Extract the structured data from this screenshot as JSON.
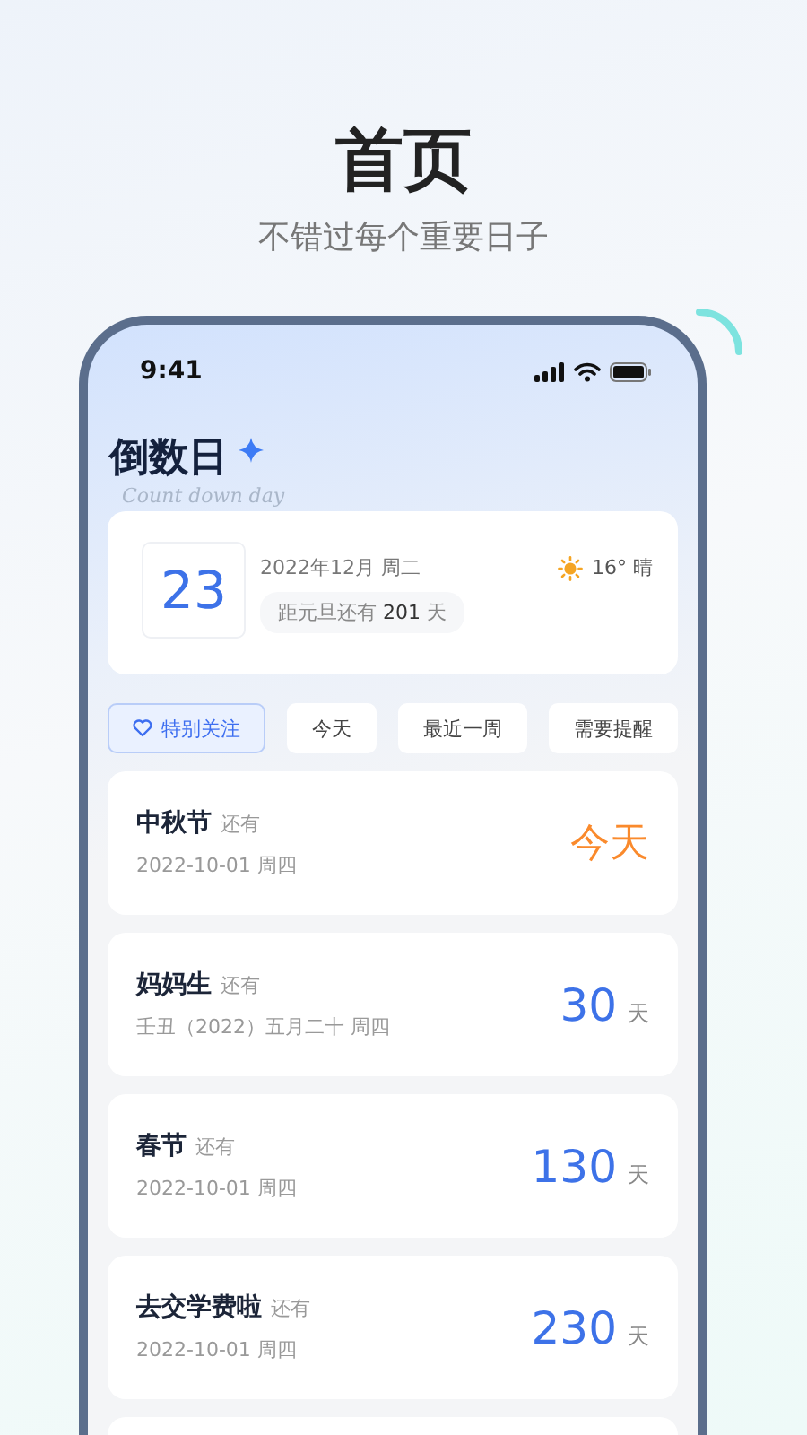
{
  "headline": {
    "title": "首页",
    "subtitle": "不错过每个重要日子"
  },
  "status_bar": {
    "time": "9:41"
  },
  "header": {
    "title": "倒数日",
    "tagline": "Count down day"
  },
  "today_card": {
    "day": "23",
    "month": "2022年12月 周二",
    "weather": "16° 晴",
    "countdown_label": "距元旦还有",
    "countdown_days": "201",
    "countdown_unit": "天"
  },
  "filters": [
    {
      "label": "特别关注",
      "selected": true
    },
    {
      "label": "今天",
      "selected": false
    },
    {
      "label": "最近一周",
      "selected": false
    },
    {
      "label": "需要提醒",
      "selected": false
    }
  ],
  "events": [
    {
      "name": "中秋节",
      "suffix": "还有",
      "date": "2022-10-01 周四",
      "kind": "today",
      "value": "今天"
    },
    {
      "name": "妈妈生",
      "suffix": "还有",
      "date": "壬丑（2022）五月二十 周四",
      "kind": "days",
      "value": "30",
      "unit": "天"
    },
    {
      "name": "春节",
      "suffix": "还有",
      "date": "2022-10-01 周四",
      "kind": "days",
      "value": "130",
      "unit": "天"
    },
    {
      "name": "去交学费啦",
      "suffix": "还有",
      "date": "2022-10-01 周四",
      "kind": "days",
      "value": "230",
      "unit": "天"
    }
  ]
}
